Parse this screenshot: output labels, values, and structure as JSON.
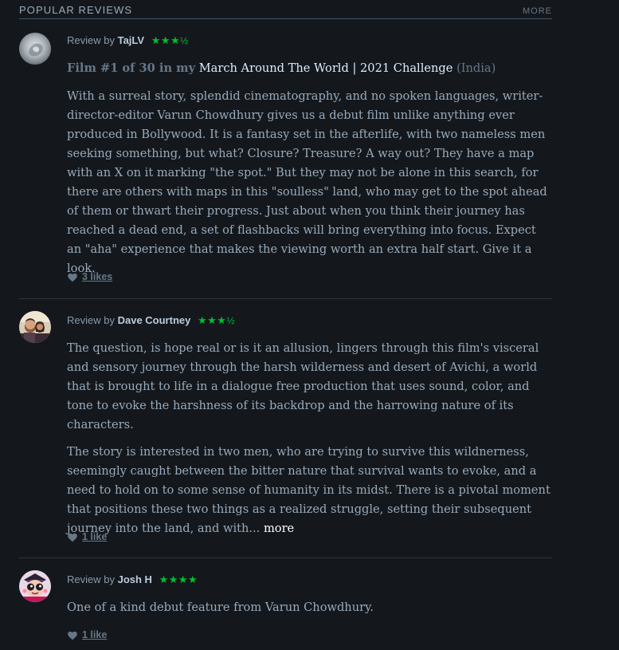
{
  "section": {
    "title": "POPULAR REVIEWS",
    "more_label": "MORE"
  },
  "reviews": [
    {
      "by_label": "Review by",
      "author": "TajLV",
      "rating_stars": "★★★",
      "rating_half": "½",
      "rating_value": 3.5,
      "list_prefix": "Film #1 of 30 in my",
      "list_name": "March Around The World | 2021 Challenge",
      "list_suffix": "(India)",
      "paragraphs": [
        "With a surreal story, splendid cinematography, and no spoken languages, writer-director-editor Varun Chowdhury gives us a debut film unlike anything ever produced in Bollywood. It is a fantasy set in the afterlife, with two nameless men seeking something, but what? Closure? Treasure? A way out? They have a map with an X on it marking \"the spot.\" But they may not be alone in this search, for there are others with maps in this \"soulless\" land, who may get to the spot ahead of them or thwart their progress. Just about when you think their journey has reached a dead end, a set of flashbacks will bring everything into focus. Expect an \"aha\" experience that makes the viewing worth an extra half start. Give it a look."
      ],
      "likes": "3 likes"
    },
    {
      "by_label": "Review by",
      "author": "Dave Courtney",
      "rating_stars": "★★★",
      "rating_half": "½",
      "rating_value": 3.5,
      "paragraphs": [
        "The question, is hope real or is it an allusion, lingers through this film's visceral and sensory journey through the harsh wilderness and desert of Avichi, a world that is brought to life in a dialogue free production that uses sound, color, and tone to evoke the harshness of its backdrop and the harrowing nature of its characters.",
        "The story is interested in two men, who are trying to survive this wildnerness, seemingly caught between the bitter nature that survival wants to evoke, and a need to hold on to some sense of humanity in its midst. There is a pivotal moment that positions these two things as a realized struggle, setting their subsequent journey into the land, and with..."
      ],
      "more_label": "more",
      "likes": "1 like"
    },
    {
      "by_label": "Review by",
      "author": "Josh H",
      "rating_stars": "★★★★",
      "rating_half": "",
      "rating_value": 4,
      "paragraphs": [
        "One of a kind debut feature from Varun Chowdhury."
      ],
      "likes": "1 like"
    }
  ],
  "colors": {
    "background": "#14181c",
    "rating_green": "#00c030",
    "text": "#99aabb",
    "link": "#ddeeff"
  }
}
